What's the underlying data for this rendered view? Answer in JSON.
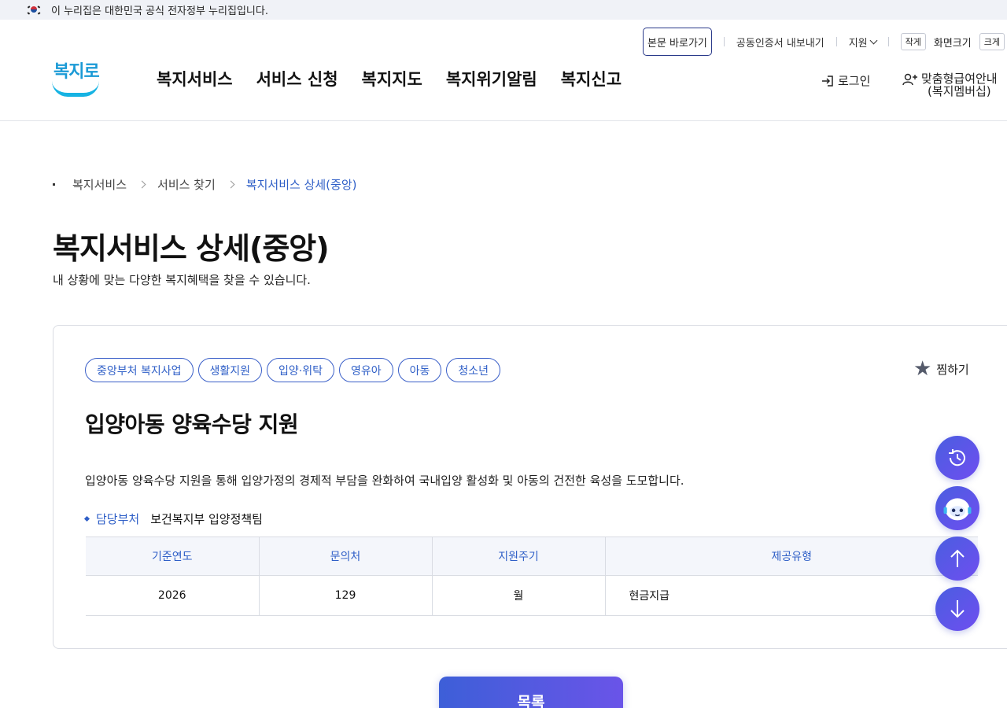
{
  "gov_banner": {
    "text": "이 누리집은 대한민국 공식 전자정부 누리집입니다."
  },
  "utility": {
    "skip": "본문 바로가기",
    "cert_export": "공동인증서 내보내기",
    "lang": "지원",
    "font_small": "작게",
    "font_label": "화면크기",
    "font_large": "크게"
  },
  "logo": {
    "text": "복지로"
  },
  "gnb": [
    {
      "label": "복지서비스"
    },
    {
      "label": "서비스 신청"
    },
    {
      "label": "복지지도"
    },
    {
      "label": "복지위기알림"
    },
    {
      "label": "복지신고"
    }
  ],
  "header_actions": {
    "login": "로그인",
    "member_line1": "맞춤형급여안내",
    "member_line2": "(복지멤버십)"
  },
  "breadcrumb": [
    "복지서비스",
    "서비스 찾기",
    "복지서비스 상세(중앙)"
  ],
  "page": {
    "title": "복지서비스 상세(중앙)",
    "description": "내 상황에 맞는 다양한 복지혜택을 찾을 수 있습니다."
  },
  "service": {
    "tags": [
      "중앙부처 복지사업",
      "생활지원",
      "입양·위탁",
      "영유아",
      "아동",
      "청소년"
    ],
    "bookmark": "찜하기",
    "title": "입양아동 양육수당 지원",
    "description": "입양아동 양육수당 지원을 통해 입양가정의 경제적 부담을 완화하여 국내입양 활성화 및 아동의 건전한 육성을 도모합니다.",
    "dept_label": "담당부처",
    "dept_value": "보건복지부 입양정책팀",
    "table": {
      "headers": [
        "기준연도",
        "문의처",
        "지원주기",
        "제공유형"
      ],
      "rows": [
        [
          "2026",
          "129",
          "월",
          "현금지급"
        ]
      ]
    }
  },
  "list_button": "목록",
  "icons": {
    "history": "history-icon",
    "chatbot": "chatbot-icon",
    "top": "arrow-up-icon",
    "bottom": "arrow-down-icon"
  },
  "colors": {
    "accent": "#2f5fc7",
    "fab_gradient_start": "#4a5ee0",
    "fab_gradient_end": "#6f4ef0"
  }
}
